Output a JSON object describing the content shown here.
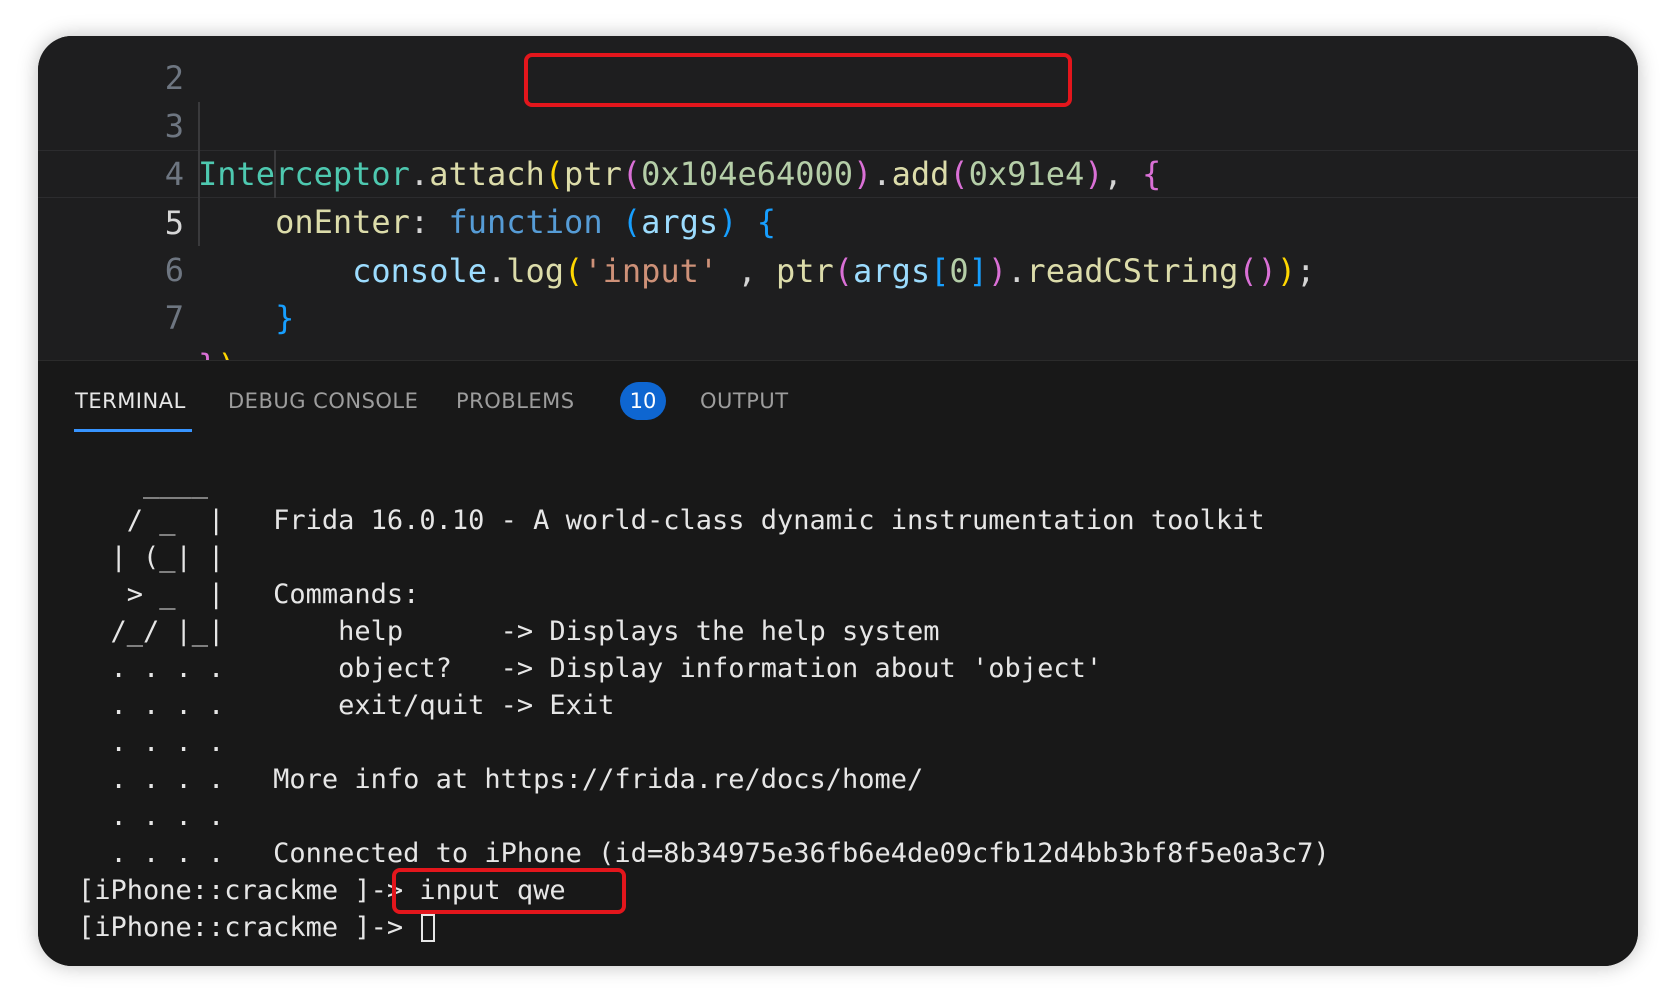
{
  "editor": {
    "partial_line_number": "2",
    "lines": [
      {
        "number": "3"
      },
      {
        "number": "4"
      },
      {
        "number": "5"
      },
      {
        "number": "6"
      },
      {
        "number": "7"
      }
    ],
    "tokens": {
      "interceptor": "Interceptor",
      "dot": ".",
      "attach": "attach",
      "paren_open": "(",
      "paren_close": ")",
      "ptr": "ptr",
      "address": "0x104e64000",
      "add": "add",
      "offset": "0x91e4",
      "comma": ",",
      "brace_open": "{",
      "brace_close": "}",
      "on_enter": "onEnter",
      "colon": ":",
      "function_kw": "function",
      "args": "args",
      "console": "console",
      "log": "log",
      "input_str": "'input'",
      "space_comma": " ,",
      "bracket_open": "[",
      "zero": "0",
      "bracket_close": "]",
      "read_cstring": "readCString",
      "semicolon": ";"
    }
  },
  "panel": {
    "tabs": [
      {
        "label": "TERMINAL"
      },
      {
        "label": "DEBUG CONSOLE"
      },
      {
        "label": "PROBLEMS"
      },
      {
        "label": "OUTPUT"
      }
    ],
    "problems_count": "10"
  },
  "terminal": {
    "lines": [
      "    ____",
      "   / _  |   Frida 16.0.10 - A world-class dynamic instrumentation toolkit",
      "  | (_| |",
      "   > _  |   Commands:",
      "  /_/ |_|       help      -> Displays the help system",
      "  . . . .       object?   -> Display information about 'object'",
      "  . . . .       exit/quit -> Exit",
      "  . . . .",
      "  . . . .   More info at https://frida.re/docs/home/",
      "  . . . .",
      "  . . . .   Connected to iPhone (id=8b34975e36fb6e4de09cfb12d4bb3bf8f5e0a3c7)",
      "[iPhone::crackme ]-> input qwe",
      "[iPhone::crackme ]-> "
    ]
  },
  "colors": {
    "highlight": "#e3161c",
    "badge": "#0e66d1",
    "tab_underline": "#3794ff"
  }
}
